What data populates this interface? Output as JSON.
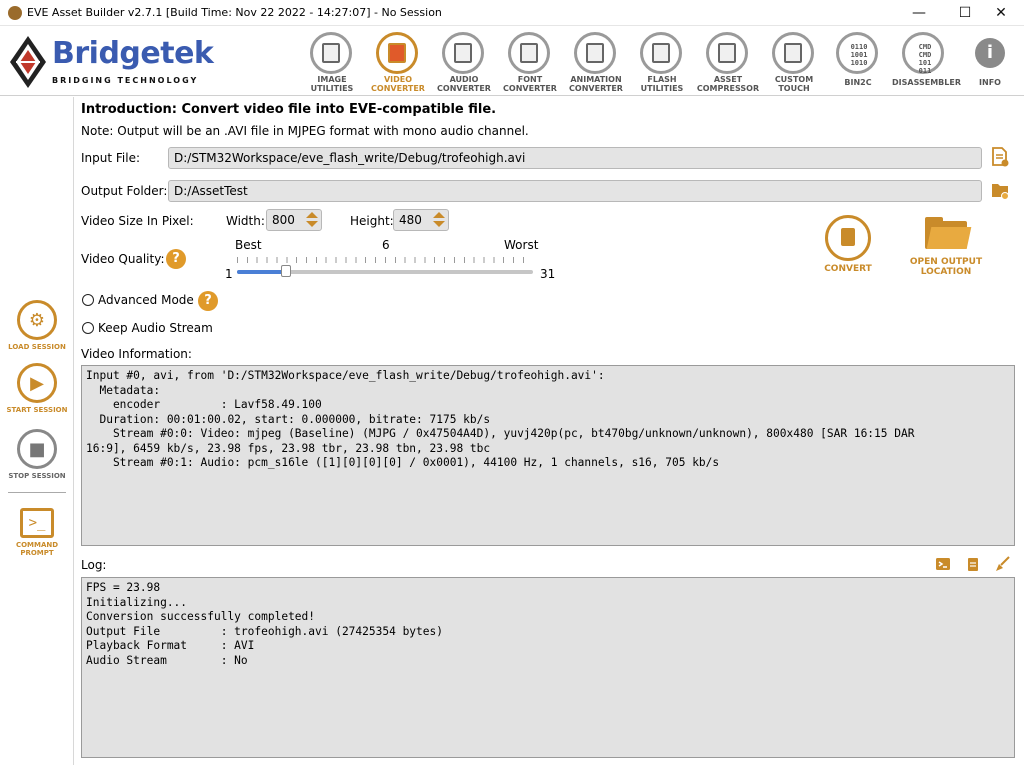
{
  "window": {
    "title": "EVE Asset Builder v2.7.1 [Build Time: Nov 22 2022 - 14:27:07] - No Session",
    "min": "—",
    "max": "☐",
    "close": "✕"
  },
  "brand": {
    "name": "Bridgetek",
    "tagline": "BRIDGING   TECHNOLOGY",
    "color": "#3a5bb0"
  },
  "toolbar": [
    {
      "label": "IMAGE UTILITIES"
    },
    {
      "label": "VIDEO CONVERTER"
    },
    {
      "label": "AUDIO CONVERTER"
    },
    {
      "label": "FONT CONVERTER"
    },
    {
      "label": "ANIMATION CONVERTER"
    },
    {
      "label": "FLASH UTILITIES"
    },
    {
      "label": "ASSET COMPRESSOR"
    },
    {
      "label": "CUSTOM TOUCH"
    },
    {
      "label": "BIN2C",
      "badge": "0110 1001 1010"
    },
    {
      "label": "DISASSEMBLER",
      "badge": "CMD CMD 101 011"
    },
    {
      "label": "INFO"
    }
  ],
  "sidebar": {
    "load_session": "LOAD SESSION",
    "start_session": "START SESSION",
    "stop_session": "STOP SESSION",
    "command_prompt": "COMMAND PROMPT"
  },
  "main": {
    "intro": "Introduction: Convert video file into EVE-compatible file.",
    "note": "Note: Output will be an .AVI file in MJPEG format with mono audio channel.",
    "input_file_label": "Input File:",
    "input_file_value": "D:/STM32Workspace/eve_flash_write/Debug/trofeohigh.avi",
    "output_folder_label": "Output Folder:",
    "output_folder_value": "D:/AssetTest",
    "video_size_label": "Video Size In Pixel:",
    "width_label": "Width:",
    "width_value": "800",
    "height_label": "Height:",
    "height_value": "480",
    "quality_label": "Video Quality:",
    "quality_best": "Best",
    "quality_current": "6",
    "quality_worst": "Worst",
    "quality_min": "1",
    "quality_max": "31",
    "quality_level": 6,
    "advanced_mode": "Advanced Mode",
    "keep_audio": "Keep Audio Stream",
    "convert": "CONVERT",
    "open_output": "OPEN OUTPUT LOCATION",
    "video_info_label": "Video Information:",
    "video_info": "Input #0, avi, from 'D:/STM32Workspace/eve_flash_write/Debug/trofeohigh.avi':\n  Metadata:\n    encoder         : Lavf58.49.100\n  Duration: 00:01:00.02, start: 0.000000, bitrate: 7175 kb/s\n    Stream #0:0: Video: mjpeg (Baseline) (MJPG / 0x47504A4D), yuvj420p(pc, bt470bg/unknown/unknown), 800x480 [SAR 16:15 DAR\n16:9], 6459 kb/s, 23.98 fps, 23.98 tbr, 23.98 tbn, 23.98 tbc\n    Stream #0:1: Audio: pcm_s16le ([1][0][0][0] / 0x0001), 44100 Hz, 1 channels, s16, 705 kb/s",
    "log_label": "Log:",
    "log": "FPS = 23.98\nInitializing...\nConversion successfully completed!\nOutput File         : trofeohigh.avi (27425354 bytes)\nPlayback Format     : AVI\nAudio Stream        : No"
  },
  "colors": {
    "accent": "#c98b2a",
    "field_bg": "#e4e4e4",
    "slider": "#4a7fd6"
  }
}
